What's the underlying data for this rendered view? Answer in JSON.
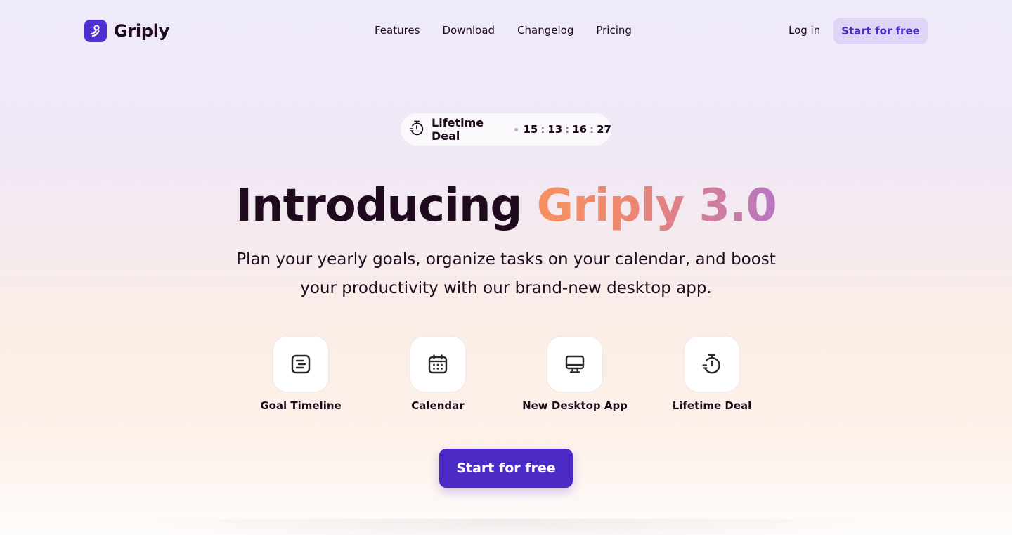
{
  "brand": {
    "name": "Griply",
    "logo_icon": "griply-logo-icon",
    "accent": "#4f2fd0"
  },
  "nav": {
    "links": [
      "Features",
      "Download",
      "Changelog",
      "Pricing"
    ],
    "login": "Log in",
    "cta": "Start for free"
  },
  "deal": {
    "icon": "stopwatch-icon",
    "label": "Lifetime Deal",
    "timer": [
      "15",
      "13",
      "16",
      "27"
    ]
  },
  "hero": {
    "title_prefix": "Introducing",
    "title_highlight": "Griply 3.0",
    "subtitle": "Plan your yearly goals, organize tasks on your calendar, and boost your productivity with our brand-new desktop app."
  },
  "features": [
    {
      "label": "Goal Timeline",
      "icon": "timeline-icon"
    },
    {
      "label": "Calendar",
      "icon": "calendar-icon"
    },
    {
      "label": "New Desktop App",
      "icon": "monitor-icon"
    },
    {
      "label": "Lifetime Deal",
      "icon": "stopwatch-icon"
    }
  ],
  "cta": {
    "label": "Start for free",
    "color": "#4c2ac6"
  }
}
